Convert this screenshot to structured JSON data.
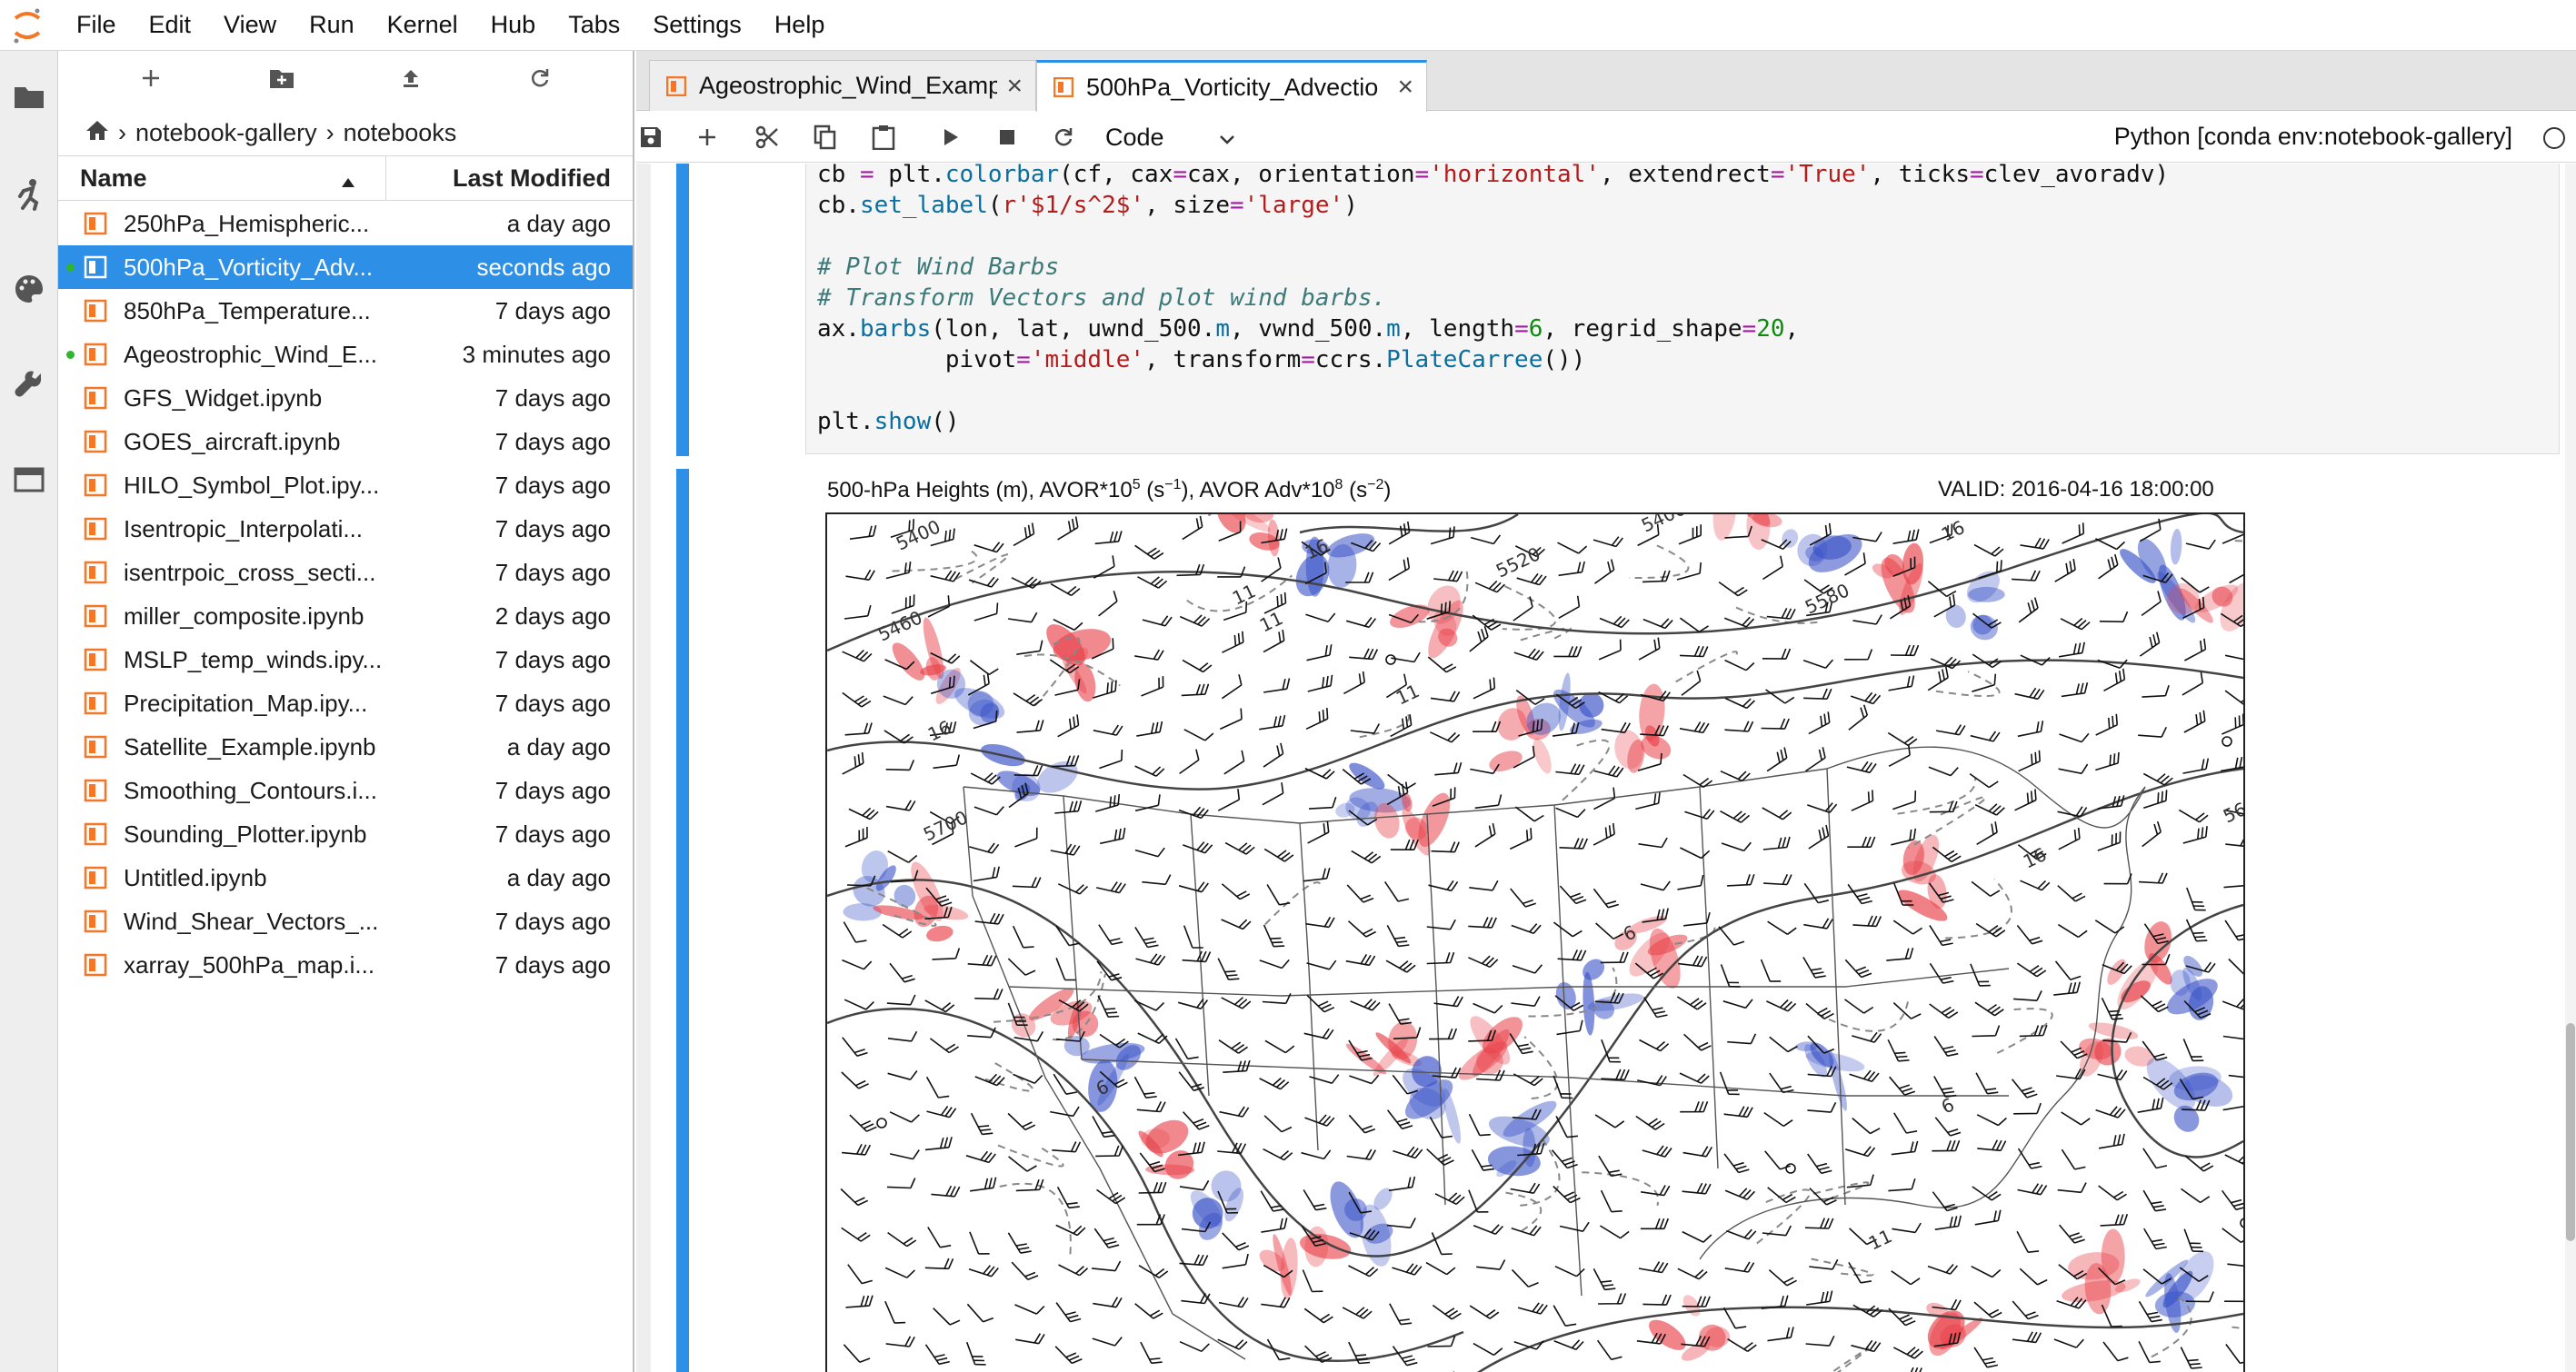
{
  "menu": {
    "items": [
      "File",
      "Edit",
      "View",
      "Run",
      "Kernel",
      "Hub",
      "Tabs",
      "Settings",
      "Help"
    ]
  },
  "activity_icons": [
    "folder-icon",
    "running-icon",
    "palette-icon",
    "wrench-icon",
    "tabs-icon"
  ],
  "file_browser": {
    "toolbar_icons": [
      "new-launcher-icon",
      "new-folder-icon",
      "upload-icon",
      "refresh-icon"
    ],
    "breadcrumb": [
      "notebook-gallery",
      "notebooks"
    ],
    "breadcrumb_sep": "›",
    "header": {
      "name": "Name",
      "modified": "Last Modified"
    },
    "files": [
      {
        "name": "250hPa_Hemispheric...",
        "modified": "a day ago",
        "running": false,
        "selected": false
      },
      {
        "name": "500hPa_Vorticity_Adv...",
        "modified": "seconds ago",
        "running": true,
        "selected": true
      },
      {
        "name": "850hPa_Temperature...",
        "modified": "7 days ago",
        "running": false,
        "selected": false
      },
      {
        "name": "Ageostrophic_Wind_E...",
        "modified": "3 minutes ago",
        "running": true,
        "selected": false
      },
      {
        "name": "GFS_Widget.ipynb",
        "modified": "7 days ago",
        "running": false,
        "selected": false
      },
      {
        "name": "GOES_aircraft.ipynb",
        "modified": "7 days ago",
        "running": false,
        "selected": false
      },
      {
        "name": "HILO_Symbol_Plot.ipy...",
        "modified": "7 days ago",
        "running": false,
        "selected": false
      },
      {
        "name": "Isentropic_Interpolati...",
        "modified": "7 days ago",
        "running": false,
        "selected": false
      },
      {
        "name": "isentrpoic_cross_secti...",
        "modified": "7 days ago",
        "running": false,
        "selected": false
      },
      {
        "name": "miller_composite.ipynb",
        "modified": "2 days ago",
        "running": false,
        "selected": false
      },
      {
        "name": "MSLP_temp_winds.ipy...",
        "modified": "7 days ago",
        "running": false,
        "selected": false
      },
      {
        "name": "Precipitation_Map.ipy...",
        "modified": "7 days ago",
        "running": false,
        "selected": false
      },
      {
        "name": "Satellite_Example.ipynb",
        "modified": "a day ago",
        "running": false,
        "selected": false
      },
      {
        "name": "Smoothing_Contours.i...",
        "modified": "7 days ago",
        "running": false,
        "selected": false
      },
      {
        "name": "Sounding_Plotter.ipynb",
        "modified": "7 days ago",
        "running": false,
        "selected": false
      },
      {
        "name": "Untitled.ipynb",
        "modified": "a day ago",
        "running": false,
        "selected": false
      },
      {
        "name": "Wind_Shear_Vectors_...",
        "modified": "7 days ago",
        "running": false,
        "selected": false
      },
      {
        "name": "xarray_500hPa_map.i...",
        "modified": "7 days ago",
        "running": false,
        "selected": false
      }
    ]
  },
  "tabs": [
    {
      "label": "Ageostrophic_Wind_Examp",
      "active": false
    },
    {
      "label": "500hPa_Vorticity_Advectio",
      "active": true
    }
  ],
  "notebook_toolbar": {
    "icons": [
      "save-icon",
      "add-cell-icon",
      "cut-icon",
      "copy-icon",
      "paste-icon",
      "run-icon",
      "stop-icon",
      "restart-icon"
    ],
    "cell_type": "Code",
    "kernel": "Python [conda env:notebook-gallery]"
  },
  "code_lines": [
    "cb = plt.colorbar(cf, cax=cax, orientation='horizontal', extendrect='True', ticks=clev_avoradv)",
    "cb.set_label(r'$1/s^2$', size='large')",
    "",
    "# Plot Wind Barbs",
    "# Transform Vectors and plot wind barbs.",
    "ax.barbs(lon, lat, uwnd_500.m, vwnd_500.m, length=6, regrid_shape=20,",
    "         pivot='middle', transform=ccrs.PlateCarree())",
    "",
    "plt.show()"
  ],
  "plot": {
    "title_base": "500-hPa Heights (m), AVOR*10",
    "title_exp1": "5",
    "title_unit1_pre": " (s",
    "title_unit1_exp": "−1",
    "title_unit1_post": "), AVOR Adv*10",
    "title_exp2": "8",
    "title_unit2_pre": " (s",
    "title_unit2_exp": "−2",
    "title_unit2_post": ")",
    "valid": "VALID: 2016-04-16 18:00:00",
    "contour_labels": [
      "5400",
      "5460",
      "5700",
      "5400",
      "5520",
      "5580",
      "56",
      "11",
      "11",
      "11",
      "16",
      "16",
      "16",
      "16",
      "6",
      "6",
      "6",
      "6",
      "11"
    ],
    "colors": {
      "positive": "#e8434b",
      "negative": "#3a53c7",
      "contour": "#444444",
      "dashed": "#888888"
    }
  },
  "colors": {
    "accent": "#2d8fe6",
    "file_icon": "#f37726",
    "running_dot": "#2fb52f"
  }
}
